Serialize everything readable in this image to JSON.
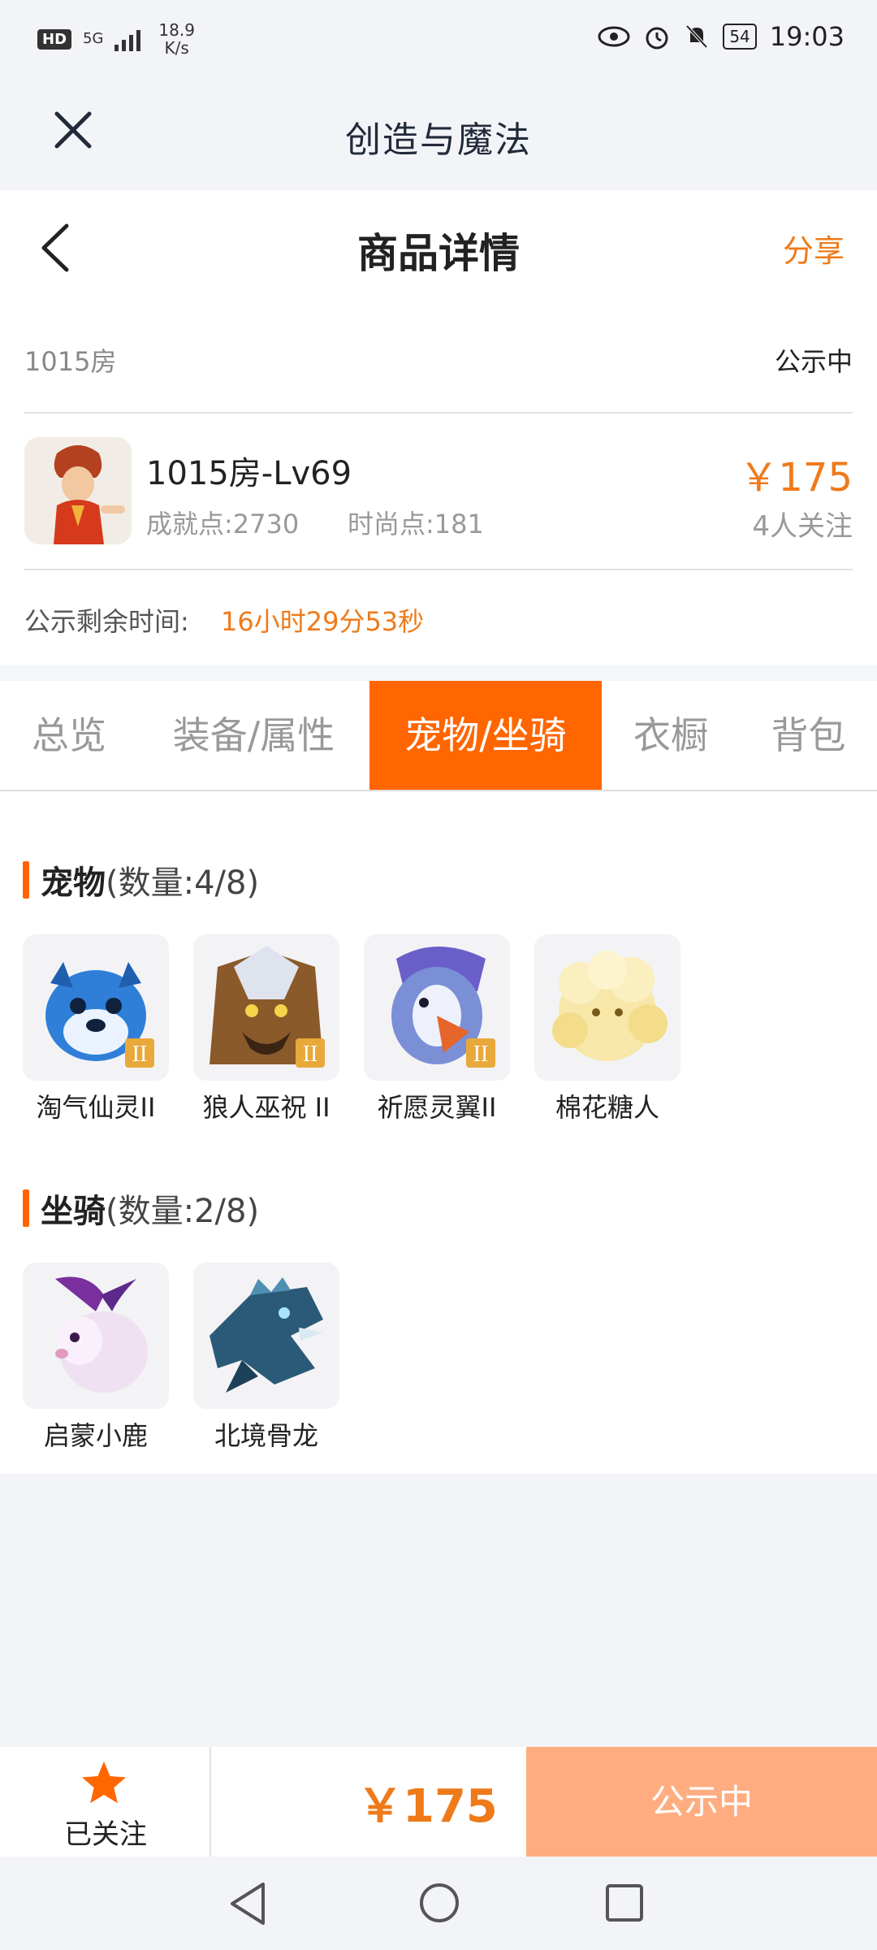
{
  "status_bar": {
    "left_badge": "HD",
    "signal": "5G",
    "net_speed_value": "18.9",
    "net_speed_unit": "K/s",
    "battery": "54",
    "time": "19:03"
  },
  "app_bar": {
    "title": "创造与魔法"
  },
  "nav": {
    "title": "商品详情",
    "share_label": "分享"
  },
  "listing": {
    "room": "1015房",
    "status": "公示中",
    "name": "1015房-Lv69",
    "achievement": "成就点:2730",
    "fashion": "时尚点:181",
    "price": "￥175",
    "followers": "4人关注",
    "remaining_label": "公示剩余时间:",
    "remaining_value": "16小时29分53秒"
  },
  "tabs": [
    {
      "label": "总览",
      "active": false
    },
    {
      "label": "装备/属性",
      "active": false
    },
    {
      "label": "宠物/坐骑",
      "active": true
    },
    {
      "label": "衣橱",
      "active": false
    },
    {
      "label": "背包",
      "active": false
    }
  ],
  "pets": {
    "title": "宠物",
    "count": "(数量:4/8)",
    "items": [
      {
        "name": "淘气仙灵II",
        "icon": "blue-dog-pet-icon"
      },
      {
        "name": "狼人巫祝 II",
        "icon": "werewolf-pet-icon"
      },
      {
        "name": "祈愿灵翼II",
        "icon": "eagle-pet-icon"
      },
      {
        "name": "棉花糖人",
        "icon": "marshmallow-pet-icon"
      }
    ]
  },
  "mounts": {
    "title": "坐骑",
    "count": "(数量:2/8)",
    "items": [
      {
        "name": "启蒙小鹿",
        "icon": "fawn-mount-icon"
      },
      {
        "name": "北境骨龙",
        "icon": "bone-dragon-mount-icon"
      }
    ]
  },
  "bottom_bar": {
    "follow_label": "已关注",
    "price": "￥175",
    "action_label": "公示中"
  },
  "colors": {
    "accent": "#ff6600",
    "price": "#ef7a1a",
    "action_disabled": "#ffad80"
  }
}
